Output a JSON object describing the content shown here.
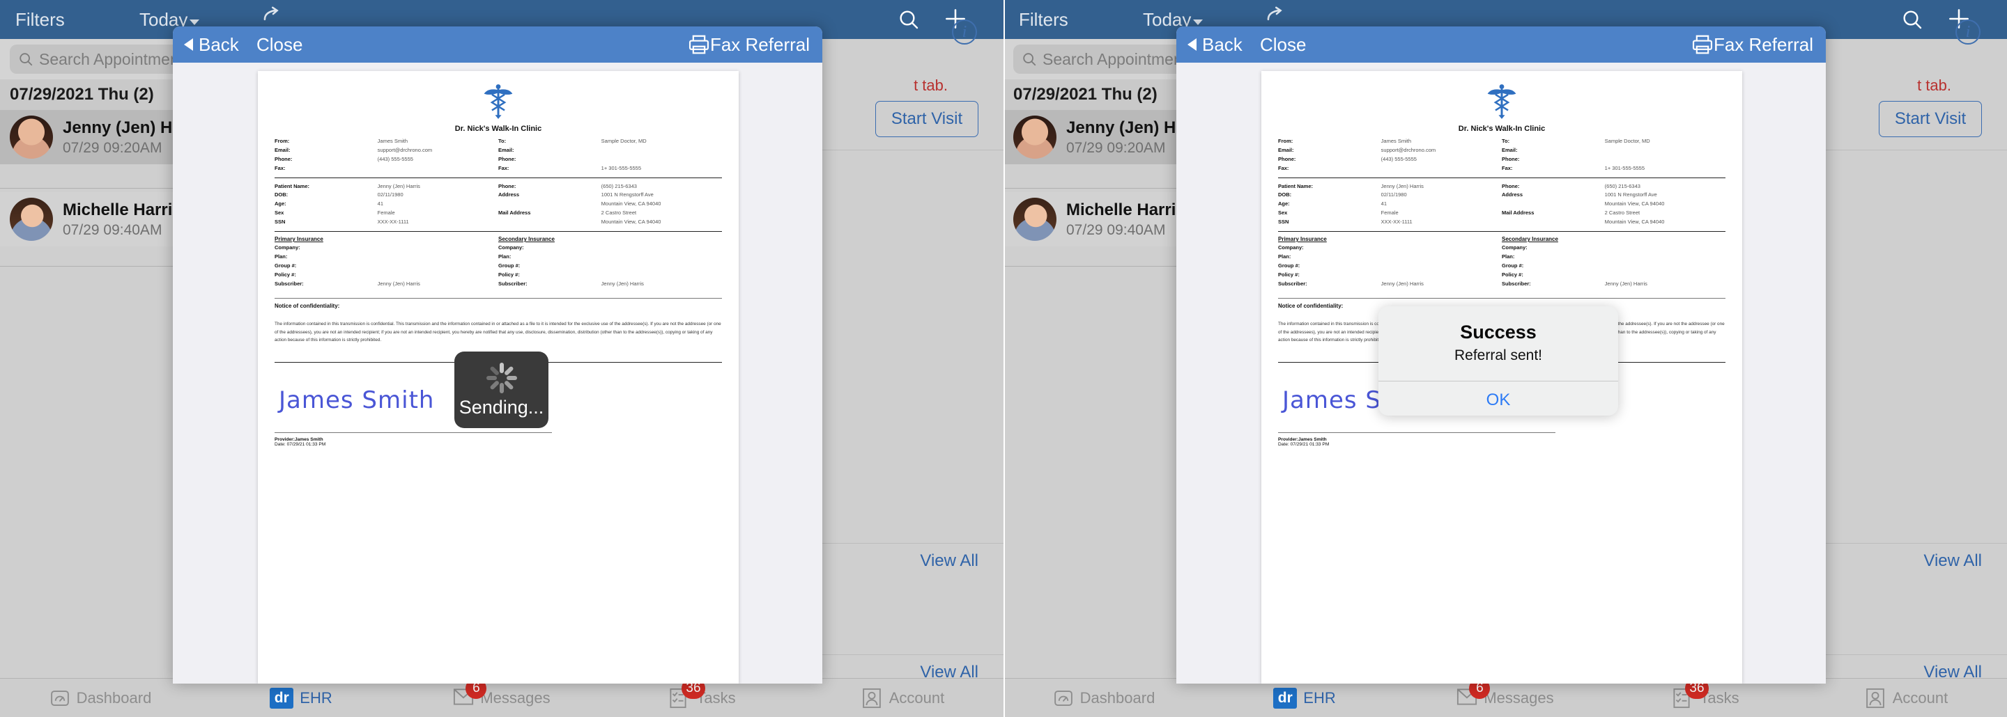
{
  "navbar": {
    "filters": "Filters",
    "today": "Today",
    "share_icon": "share-icon",
    "search_icon": "search-icon",
    "plus_icon": "plus-icon"
  },
  "search": {
    "placeholder": "Search Appointments",
    "icon": "search-icon"
  },
  "schedule": {
    "date_header": "07/29/2021 Thu (2)",
    "appointments": [
      {
        "name": "Jenny (Jen) Harris",
        "time": "07/29 09:20AM"
      },
      {
        "name": "Michelle Harris",
        "time": "07/29 09:40AM"
      }
    ]
  },
  "detail": {
    "warning": "t tab.",
    "info_icon": "info-icon",
    "start_visit": "Start Visit",
    "view_all_1": "View All",
    "view_all_2": "View All"
  },
  "modal": {
    "back": "Back",
    "close": "Close",
    "title": "Fax Referral",
    "print_icon": "printer-icon"
  },
  "document": {
    "logo_icon": "caduceus-icon",
    "clinic": "Dr. Nick's Walk-In Clinic",
    "from_block": [
      {
        "key": "From:",
        "value": "James Smith"
      },
      {
        "key": "Email:",
        "value": "support@drchrono.com"
      },
      {
        "key": "Phone:",
        "value": "(443) 555-5555"
      },
      {
        "key": "Fax:",
        "value": ""
      }
    ],
    "to_block": [
      {
        "key": "To:",
        "value": "Sample Doctor, MD"
      },
      {
        "key": "Email:",
        "value": ""
      },
      {
        "key": "Phone:",
        "value": ""
      },
      {
        "key": "Fax:",
        "value": "1+ 301-555-5555"
      }
    ],
    "patient_block": [
      {
        "key": "Patient Name:",
        "value": "Jenny (Jen) Harris"
      },
      {
        "key": "DOB:",
        "value": "02/11/1980"
      },
      {
        "key": "Age:",
        "value": "41"
      },
      {
        "key": "Sex",
        "value": "Female"
      },
      {
        "key": "SSN",
        "value": "XXX-XX-1111"
      }
    ],
    "contact_block": [
      {
        "key": "Phone:",
        "value": "(650) 215-6343"
      },
      {
        "key": "Address",
        "value": "1001 N Rengstorff Ave"
      },
      {
        "key": "",
        "value": "Mountain View, CA 94040"
      },
      {
        "key": "Mail Address",
        "value": "2 Castro Street"
      },
      {
        "key": "",
        "value": "Mountain View, CA 94040"
      }
    ],
    "primary_insurance": {
      "heading": "Primary Insurance",
      "rows": [
        {
          "key": "Company:",
          "value": ""
        },
        {
          "key": "Plan:",
          "value": ""
        },
        {
          "key": "Group #:",
          "value": ""
        },
        {
          "key": "Policy #:",
          "value": ""
        },
        {
          "key": "Subscriber:",
          "value": "Jenny (Jen) Harris"
        }
      ]
    },
    "secondary_insurance": {
      "heading": "Secondary Insurance",
      "rows": [
        {
          "key": "Company:",
          "value": ""
        },
        {
          "key": "Plan:",
          "value": ""
        },
        {
          "key": "Group #:",
          "value": ""
        },
        {
          "key": "Policy #:",
          "value": ""
        },
        {
          "key": "Subscriber:",
          "value": "Jenny (Jen) Harris"
        }
      ]
    },
    "notice_heading": "Notice of confidentiality:",
    "notice_body": "The information contained in this transmission is confidential. This transmission and the information contained in or attached as a file to it is intended for the exclusive use of the addressee(s). If you are not the addressee (or one of the addressees), you are not an intended recipient; if you are not an intended recipient, you hereby are notified that any use, disclosure, dissemination, distribution (other than to the addressee(s)), copying or taking of any action because of this information is strictly prohibited.",
    "signature": "James Smith",
    "provider_line": "Provider:James Smith",
    "date_line": "Date: 07/29/21 01:33 PM"
  },
  "sending_hud": {
    "text": "Sending...",
    "icon": "spinner-icon"
  },
  "success_alert": {
    "title": "Success",
    "message": "Referral sent!",
    "ok": "OK"
  },
  "tabbar": {
    "tabs": [
      {
        "label": "Dashboard",
        "icon": "gauge-icon",
        "badge": ""
      },
      {
        "label": "EHR",
        "icon": "dr-logo-icon",
        "badge": ""
      },
      {
        "label": "Messages",
        "icon": "envelope-icon",
        "badge": "6"
      },
      {
        "label": "Tasks",
        "icon": "checklist-icon",
        "badge": "36"
      },
      {
        "label": "Account",
        "icon": "person-icon",
        "badge": ""
      }
    ]
  },
  "colors": {
    "nav": "#33608f",
    "modal_header": "#4d82c8",
    "link": "#2f63a8",
    "badge": "#cf2a23",
    "alert_action": "#2d7bf5"
  }
}
